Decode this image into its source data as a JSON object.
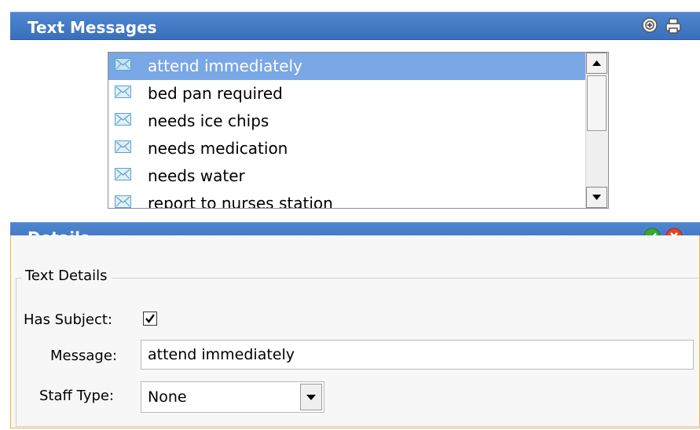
{
  "text_messages": {
    "title": "Text Messages",
    "items": [
      {
        "label": "attend immediately",
        "selected": true
      },
      {
        "label": "bed pan required",
        "selected": false
      },
      {
        "label": "needs ice chips",
        "selected": false
      },
      {
        "label": "needs medication",
        "selected": false
      },
      {
        "label": "needs water",
        "selected": false
      },
      {
        "label": "report to nurses station",
        "selected": false
      }
    ]
  },
  "details": {
    "title": "Details",
    "group_label": "Text Details",
    "has_subject_label": "Has Subject:",
    "has_subject_checked": true,
    "message_label": "Message:",
    "message_value": "attend immediately",
    "staff_type_label": "Staff Type:",
    "staff_type_value": "None"
  },
  "colors": {
    "header_bar": "#3f76c6",
    "selection": "#7aa7e6",
    "panel_border": "#f0b44a",
    "confirm": "#3aa832",
    "cancel": "#e2452c"
  }
}
